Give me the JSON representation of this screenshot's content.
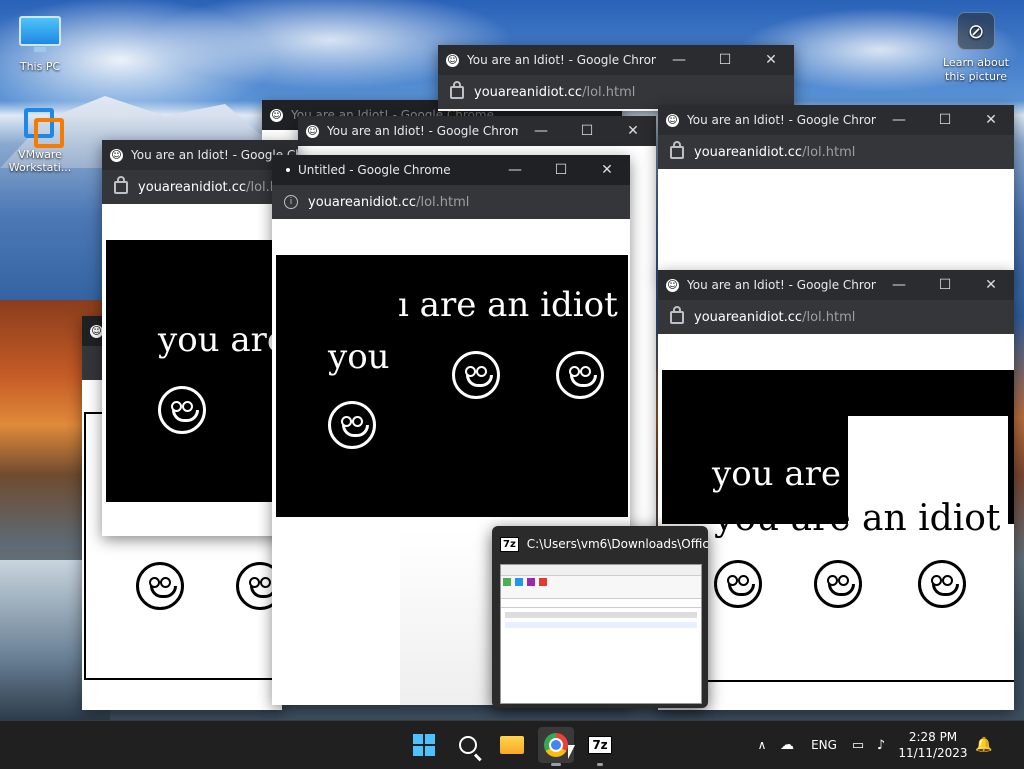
{
  "desktop": {
    "icons": [
      {
        "label": "This PC",
        "icon": "this-pc-icon"
      },
      {
        "label": "VMware Workstati...",
        "icon": "vmware-icon"
      }
    ],
    "learn_about": "Learn about this picture"
  },
  "chrome": {
    "title_idiot": "You are an Idiot! - Google Chrome",
    "title_untitled": "Untitled - Google Chrome",
    "url_host": "youareanidiot.cc",
    "url_path": "/lol.html",
    "url_host_cut": "youareanidiot.cc",
    "url_path_cut": "/lol.ht",
    "minimize": "—",
    "maximize": "☐",
    "close": "✕"
  },
  "page_text": {
    "idiot_line": "you are an idiot",
    "partial_a": "you are",
    "partial_b": "you",
    "partial_c": "ı are an idiot",
    "partial_d": "you are a",
    "partial_e": "you are an idiot"
  },
  "thumbnail": {
    "badge": "7z",
    "title": "C:\\Users\\vm6\\Downloads\\Offic..."
  },
  "taskbar": {
    "apps": [
      "start-icon",
      "search-icon",
      "file-explorer-icon",
      "chrome-icon",
      "7zip-icon"
    ],
    "badge_7z": "7z",
    "lang": "ENG",
    "time": "2:28 PM",
    "date": "11/11/2023"
  },
  "colors": {
    "titlebar": "#202124",
    "addressbar": "#35363a",
    "taskbar": "#202020"
  }
}
